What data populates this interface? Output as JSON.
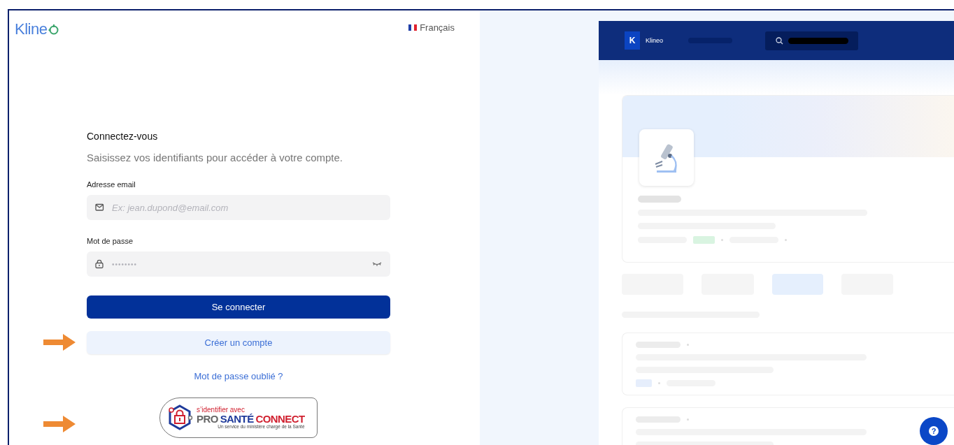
{
  "login": {
    "logo": "Kline",
    "language": {
      "label": "Français"
    },
    "title": "Connectez-vous",
    "subtitle": "Saisissez vos identifiants pour accéder à votre compte.",
    "fields": [
      {
        "kind": "email",
        "label": "Adresse email",
        "placeholder": "Ex: jean.dupond@email.com"
      },
      {
        "kind": "password",
        "label": "Mot de passe",
        "placeholder": "••••••••"
      }
    ],
    "primary_button": "Se connecter",
    "secondary_button": "Créer un compte",
    "forgot_link": "Mot de passe oublié ?",
    "pro_sante_connect": {
      "prefix": "s’identifier avec",
      "pro": "PRO",
      "sante": "SANTÉ",
      "connect": "CONNECT",
      "tagline": "Un service du ministère chargé de la Santé"
    }
  },
  "preview": {
    "logo_letter": "K",
    "app_name": "Klineo",
    "tabs": [
      {
        "selected": false
      },
      {
        "selected": false
      },
      {
        "selected": true
      },
      {
        "selected": false
      }
    ],
    "help_button": "?"
  }
}
